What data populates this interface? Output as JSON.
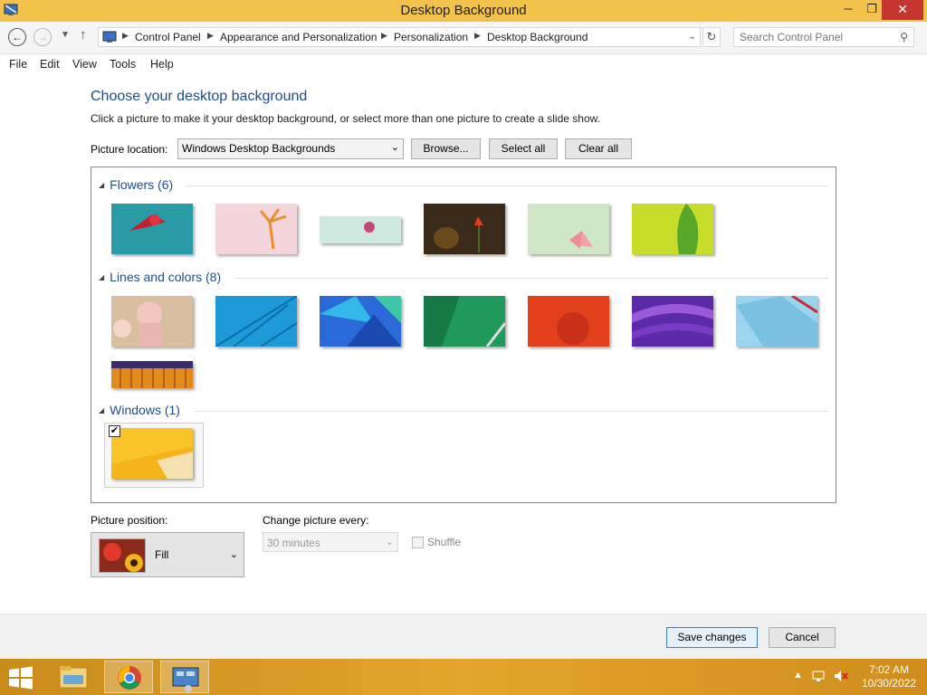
{
  "window": {
    "title": "Desktop Background",
    "minimize": "─",
    "maximize": "❐",
    "close": "✕"
  },
  "nav": {
    "breadcrumbs": [
      "Control Panel",
      "Appearance and Personalization",
      "Personalization",
      "Desktop Background"
    ],
    "search_placeholder": "Search Control Panel"
  },
  "menu": [
    "File",
    "Edit",
    "View",
    "Tools",
    "Help"
  ],
  "content": {
    "heading": "Choose your desktop background",
    "instructions": "Click a picture to make it your desktop background, or select more than one picture to create a slide show.",
    "location_label": "Picture location:",
    "location_value": "Windows Desktop Backgrounds",
    "browse_label": "Browse...",
    "select_all_label": "Select all",
    "clear_all_label": "Clear all"
  },
  "groups": [
    {
      "title": "Flowers (6)",
      "count": 6
    },
    {
      "title": "Lines and colors (8)",
      "count": 8
    },
    {
      "title": "Windows (1)",
      "count": 1,
      "selected": [
        true
      ]
    }
  ],
  "options": {
    "position_label": "Picture position:",
    "position_value": "Fill",
    "change_label": "Change picture every:",
    "change_value": "30 minutes",
    "shuffle_label": "Shuffle",
    "shuffle_checked": false
  },
  "footer": {
    "save_label": "Save changes",
    "cancel_label": "Cancel"
  },
  "taskbar": {
    "time": "7:02 AM",
    "date": "10/30/2022"
  },
  "colors": {
    "accent": "#f3c24a",
    "heading": "#1e4e8c",
    "close": "#c7352f"
  }
}
